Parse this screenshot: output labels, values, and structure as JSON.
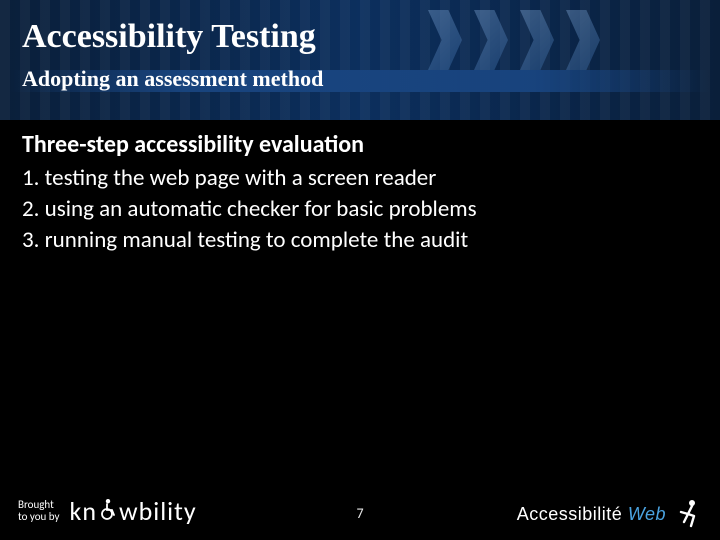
{
  "header": {
    "title": "Accessibility Testing",
    "subtitle": "Adopting an assessment method"
  },
  "content": {
    "heading": "Three-step accessibility evaluation",
    "steps": [
      "1. testing the web page with a screen reader",
      "2. using an automatic checker for basic problems",
      "3. running manual testing to complete the audit"
    ]
  },
  "footer": {
    "brought_line1": "Brought",
    "brought_line2": "to you by",
    "sponsor1_prefix": "kn",
    "sponsor1_suffix": "wbility",
    "sponsor1_name": "knowbility",
    "page_number": "7",
    "sponsor2_part1": "Accessibilité",
    "sponsor2_part2": "Web",
    "sponsor2_name": "Accessibilité Web"
  },
  "icons": {
    "wheelchair": "wheelchair-icon",
    "runner": "runner-icon"
  }
}
